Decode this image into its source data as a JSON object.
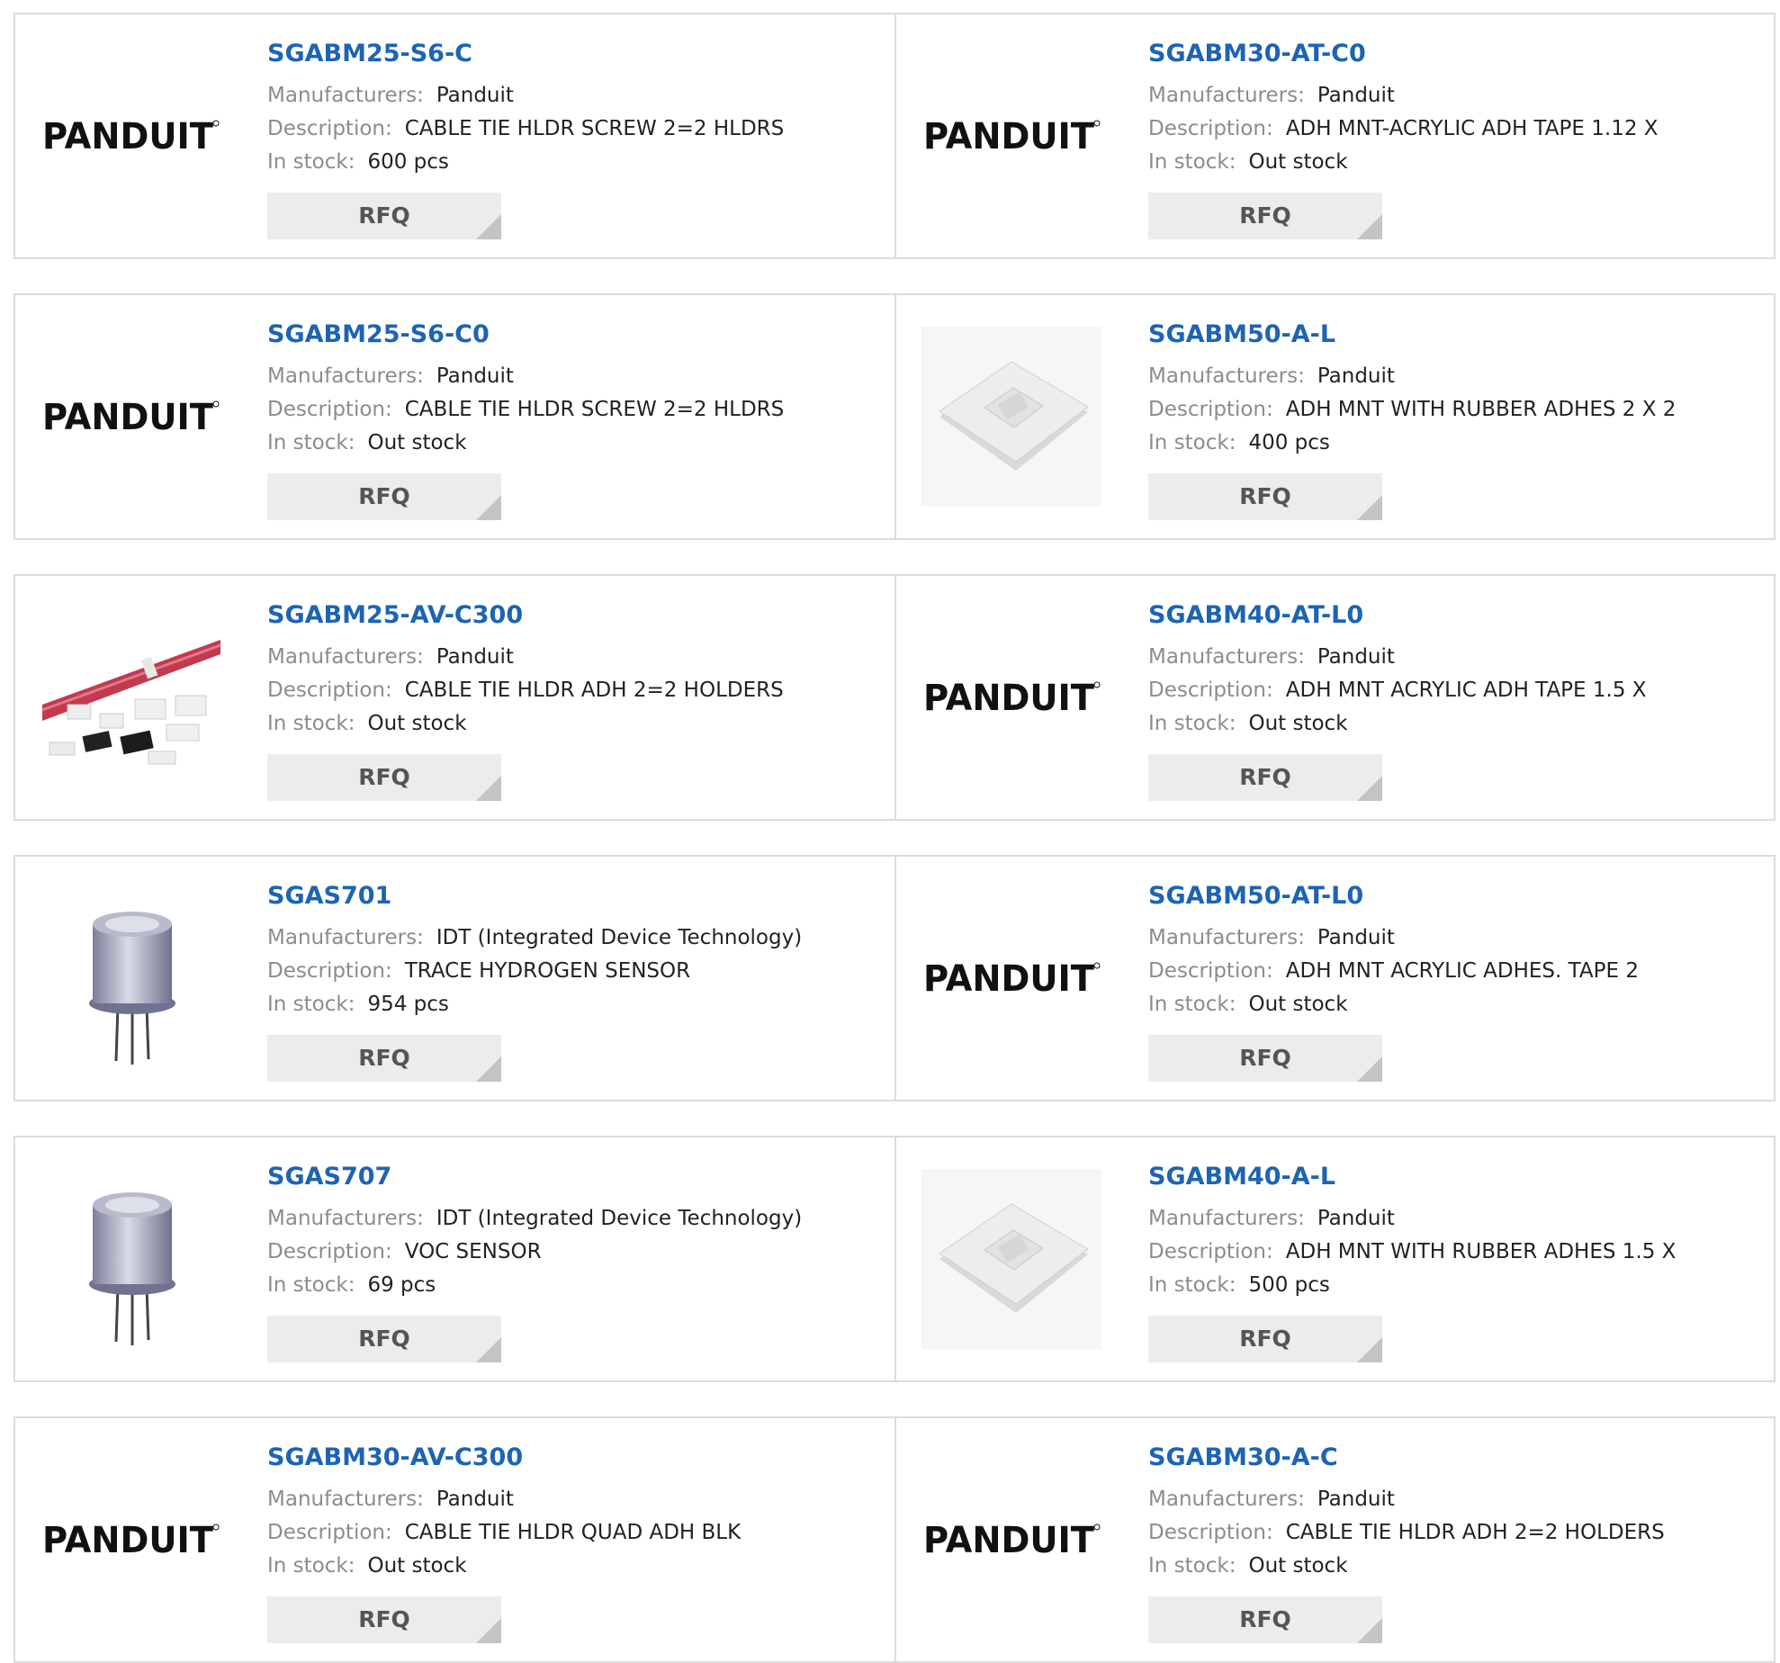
{
  "labels": {
    "manufacturers": "Manufacturers:",
    "description": "Description:",
    "in_stock": "In stock:",
    "rfq": "RFQ"
  },
  "colors": {
    "part_link": "#1d64b3",
    "label": "#8c8c8c",
    "rfq_bg": "#ececec",
    "border": "#dcdcdc"
  },
  "products": [
    {
      "part": "SGABM25-S6-C",
      "manufacturer": "Panduit",
      "description": "CABLE TIE HLDR SCREW 2=2 HLDRS",
      "stock": "600 pcs",
      "image": "panduit-logo",
      "logo_text": "PANDUIT"
    },
    {
      "part": "SGABM30-AT-C0",
      "manufacturer": "Panduit",
      "description": "ADH MNT-ACRYLIC ADH TAPE 1.12 X",
      "stock": "Out stock",
      "image": "panduit-logo",
      "logo_text": "PANDUIT"
    },
    {
      "part": "SGABM25-S6-C0",
      "manufacturer": "Panduit",
      "description": "CABLE TIE HLDR SCREW 2=2 HLDRS",
      "stock": "Out stock",
      "image": "panduit-logo",
      "logo_text": "PANDUIT"
    },
    {
      "part": "SGABM50-A-L",
      "manufacturer": "Panduit",
      "description": "ADH MNT WITH RUBBER ADHES 2 X 2",
      "stock": "400 pcs",
      "image": "adhesive-mount-photo"
    },
    {
      "part": "SGABM25-AV-C300",
      "manufacturer": "Panduit",
      "description": "CABLE TIE HLDR ADH 2=2 HOLDERS",
      "stock": "Out stock",
      "image": "cable-holders-photo"
    },
    {
      "part": "SGABM40-AT-L0",
      "manufacturer": "Panduit",
      "description": "ADH MNT ACRYLIC ADH TAPE 1.5 X",
      "stock": "Out stock",
      "image": "panduit-logo",
      "logo_text": "PANDUIT"
    },
    {
      "part": "SGAS701",
      "manufacturer": "IDT (Integrated Device Technology)",
      "description": "TRACE HYDROGEN SENSOR",
      "stock": "954 pcs",
      "image": "sensor-photo"
    },
    {
      "part": "SGABM50-AT-L0",
      "manufacturer": "Panduit",
      "description": "ADH MNT ACRYLIC ADHES. TAPE 2",
      "stock": "Out stock",
      "image": "panduit-logo",
      "logo_text": "PANDUIT"
    },
    {
      "part": "SGAS707",
      "manufacturer": "IDT (Integrated Device Technology)",
      "description": "VOC SENSOR",
      "stock": "69 pcs",
      "image": "sensor-photo"
    },
    {
      "part": "SGABM40-A-L",
      "manufacturer": "Panduit",
      "description": "ADH MNT WITH RUBBER ADHES 1.5 X",
      "stock": "500 pcs",
      "image": "adhesive-mount-photo"
    },
    {
      "part": "SGABM30-AV-C300",
      "manufacturer": "Panduit",
      "description": "CABLE TIE HLDR QUAD ADH BLK",
      "stock": "Out stock",
      "image": "panduit-logo",
      "logo_text": "PANDUIT"
    },
    {
      "part": "SGABM30-A-C",
      "manufacturer": "Panduit",
      "description": "CABLE TIE HLDR ADH 2=2 HOLDERS",
      "stock": "Out stock",
      "image": "panduit-logo",
      "logo_text": "PANDUIT"
    }
  ]
}
